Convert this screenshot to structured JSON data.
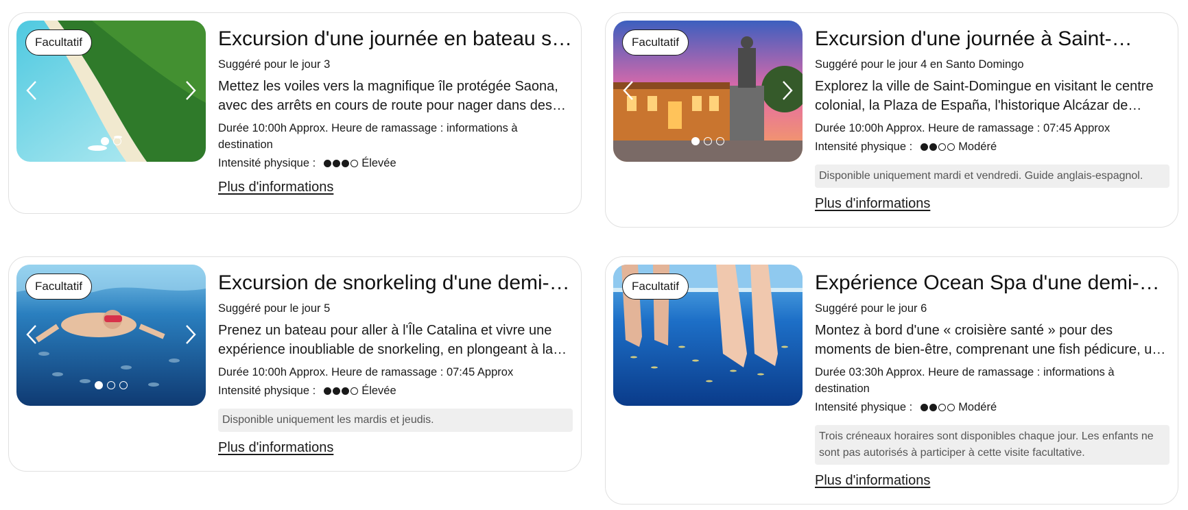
{
  "cards": [
    {
      "badge": "Facultatif",
      "title": "Excursion d'une journée en bateau sur…",
      "suggested": "Suggéré pour le jour 3",
      "description": "Mettez les voiles vers la magnifique île protégée Saona, avec des arrêts en cours de route pour nager dans des…",
      "duration": "Durée 10:00h Approx. Heure de ramassage : informations à destination",
      "intensity_label": "Intensité physique :",
      "intensity_level": 3,
      "intensity_max": 4,
      "intensity_text": "Élevée",
      "note": "",
      "more_link": "Plus d'informations",
      "image_subject": "tropical beach with palm trees and boats",
      "slides": 2,
      "active_slide": 0
    },
    {
      "badge": "Facultatif",
      "title": "Excursion d'une journée à Saint-…",
      "suggested": "Suggéré pour le jour 4 en Santo Domingo",
      "description": "Explorez la ville de Saint-Domingue en visitant le centre colonial, la Plaza de España, l'historique Alcázar de Colón, l…",
      "duration": "Durée 10:00h Approx. Heure de ramassage : 07:45 Approx",
      "intensity_label": "Intensité physique :",
      "intensity_level": 2,
      "intensity_max": 4,
      "intensity_text": "Modéré",
      "note": "Disponible uniquement mardi et vendredi. Guide anglais-espagnol.",
      "more_link": "Plus d'informations",
      "image_subject": "colonial plaza with statue at sunset",
      "slides": 3,
      "active_slide": 0
    },
    {
      "badge": "Facultatif",
      "title": "Excursion de snorkeling d'une demi-…",
      "suggested": "Suggéré pour le jour 5",
      "description": "Prenez un bateau pour aller à l'Île Catalina et vivre une expérience inoubliable de snorkeling, en plongeant à la…",
      "duration": "Durée 10:00h Approx. Heure de ramassage : 07:45 Approx",
      "intensity_label": "Intensité physique :",
      "intensity_level": 3,
      "intensity_max": 4,
      "intensity_text": "Élevée",
      "note": "Disponible uniquement les mardis et jeudis.",
      "more_link": "Plus d'informations",
      "image_subject": "snorkeler underwater among fish",
      "slides": 3,
      "active_slide": 0
    },
    {
      "badge": "Facultatif",
      "title": "Expérience Ocean Spa d'une demi-…",
      "suggested": "Suggéré pour le jour 6",
      "description": "Montez à bord d'une « croisière santé » pour des moments de bien-être, comprenant une fish pédicure, un cours de…",
      "duration": "Durée 03:30h Approx. Heure de ramassage : informations à destination",
      "intensity_label": "Intensité physique :",
      "intensity_level": 2,
      "intensity_max": 4,
      "intensity_text": "Modéré",
      "note": "Trois créneaux horaires sont disponibles chaque jour. Les enfants ne sont pas autorisés à participer à cette visite facultative.",
      "more_link": "Plus d'informations",
      "image_subject": "feet in water tank with fish pedicure",
      "slides": 0,
      "active_slide": 0
    }
  ],
  "colors": {
    "text": "#1a1a1a",
    "card_border": "#e0e0e0",
    "note_bg": "#efefef",
    "note_text": "#555555"
  }
}
